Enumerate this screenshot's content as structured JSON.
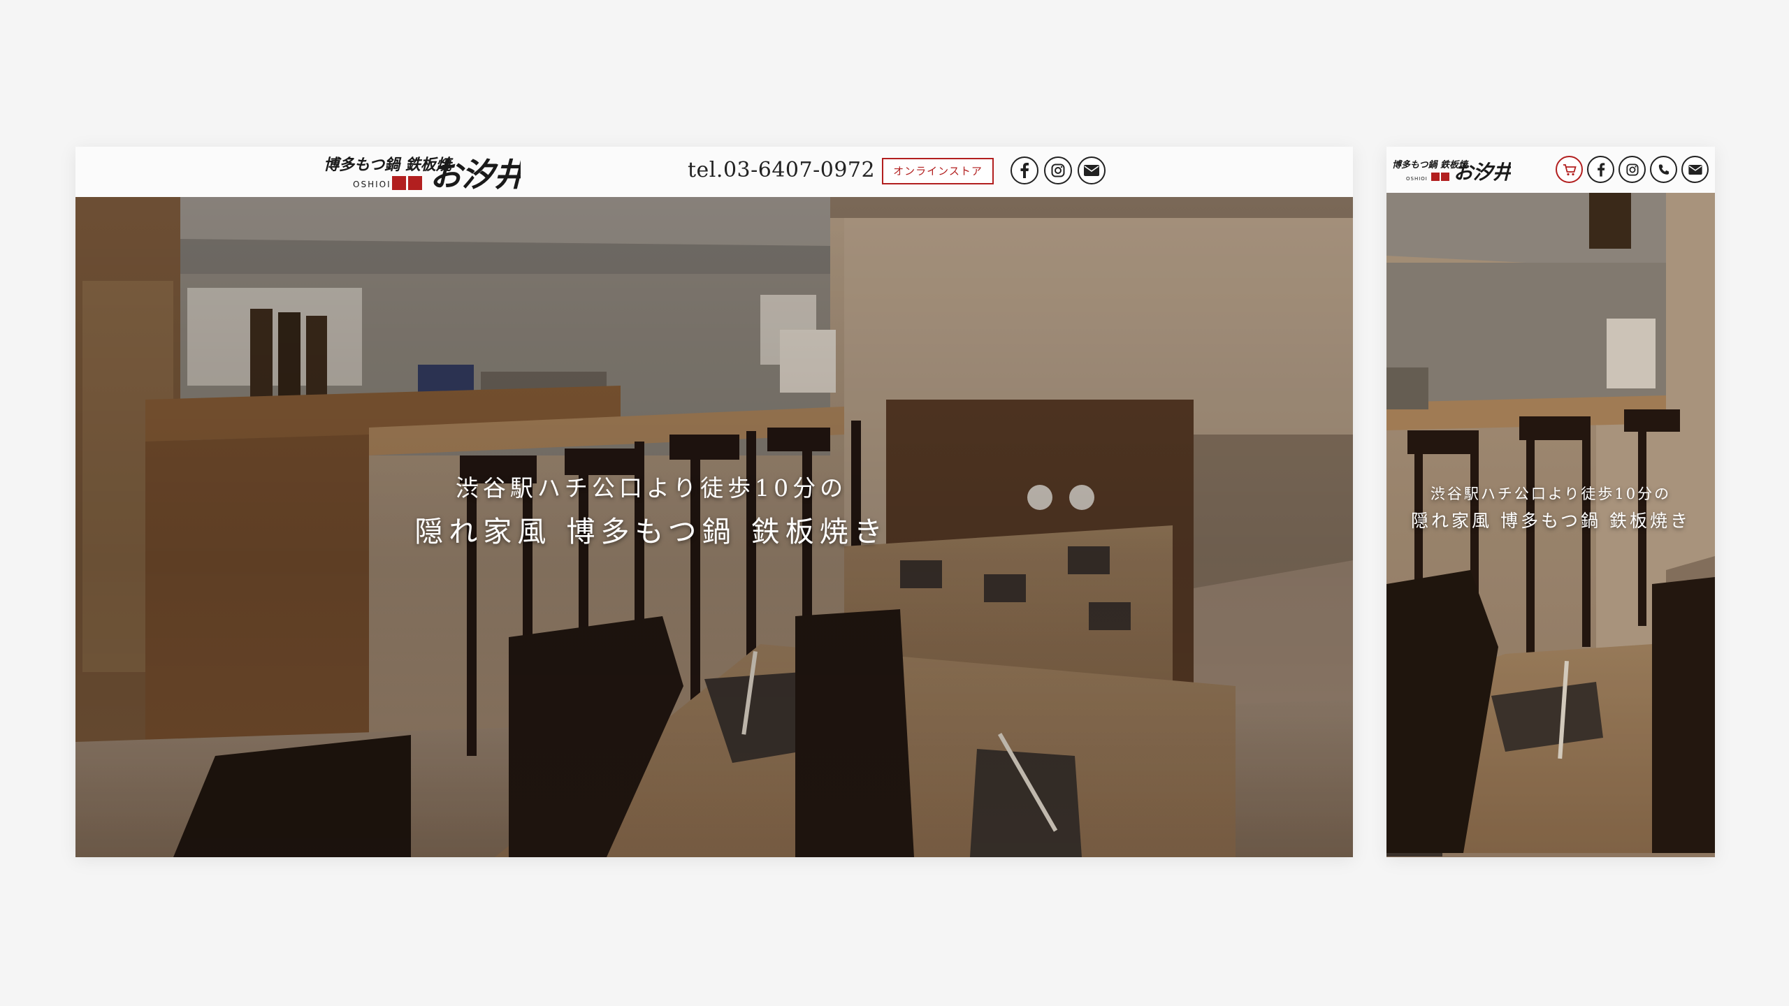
{
  "brand": {
    "logo_text": "博多もつ鍋 鉄板焼 お汐井",
    "logo_sub": "OSHIOI"
  },
  "desktop": {
    "header": {
      "tel": "tel.03-6407-0972",
      "online_store": "オンラインストア",
      "icons": [
        "facebook-icon",
        "instagram-icon",
        "mail-icon"
      ]
    },
    "hero": {
      "tagline_1": "渋谷駅ハチ公口より徒歩10分の",
      "tagline_2": "隠れ家風 博多もつ鍋 鉄板焼き"
    }
  },
  "mobile": {
    "header": {
      "icons": [
        "cart-icon",
        "facebook-icon",
        "instagram-icon",
        "phone-icon",
        "mail-icon"
      ]
    },
    "hero": {
      "tagline_1": "渋谷駅ハチ公口より徒歩10分の",
      "tagline_2": "隠れ家風 博多もつ鍋 鉄板焼き"
    }
  },
  "colors": {
    "accent_red": "#b21f1f",
    "icon_dark": "#222222",
    "page_bg": "#f5f5f5"
  }
}
